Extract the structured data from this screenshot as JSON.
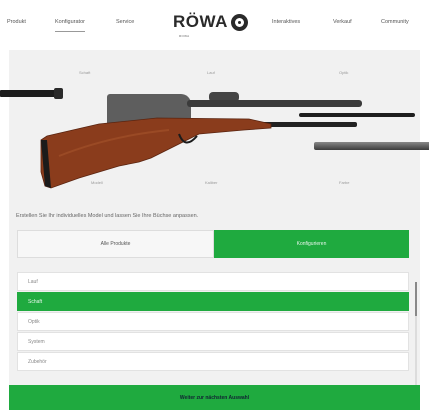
{
  "nav": {
    "left_links": [
      "Produkt",
      "Konfigurator",
      "Service"
    ],
    "right_links": [
      "Interaktives",
      "Verkauf",
      "Community"
    ],
    "logo_text": "RÖWA",
    "logo_sub": "ROWA"
  },
  "configurator": {
    "part_labels_top": [
      "Schaft",
      "Lauf",
      "Optik"
    ],
    "part_labels_bottom": [
      "Modell",
      "Kaliber",
      "Farbe"
    ],
    "intro_text": "Erstellen Sie Ihr individuelles Model und lassen Sie Ihre Büchse anpassen.",
    "toggle": {
      "left_label": "Alle Produkte",
      "right_label": "Konfigurieren"
    },
    "options": [
      "Lauf",
      "Schaft",
      "Optik",
      "System",
      "Zubehör"
    ],
    "selected_option_index": 1,
    "cta_label": "Weiter zur nächsten Auswahl"
  },
  "colors": {
    "accent": "#1faa3f",
    "panel_bg": "#f1f1f1",
    "stock_wood": "#8a3c1c"
  }
}
